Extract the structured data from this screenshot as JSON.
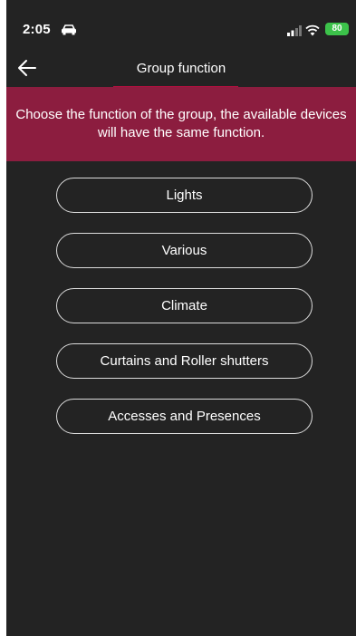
{
  "status_bar": {
    "time": "2:05",
    "battery": "80"
  },
  "header": {
    "title": "Group function"
  },
  "banner": {
    "text": "Choose the function of the group, the available devices will have the same function."
  },
  "options": [
    {
      "label": "Lights"
    },
    {
      "label": "Various"
    },
    {
      "label": "Climate"
    },
    {
      "label": "Curtains and Roller shutters"
    },
    {
      "label": "Accesses and Presences"
    }
  ],
  "colors": {
    "background": "#232323",
    "accent": "#8c1d3f",
    "underline": "#b0103f",
    "battery": "#3cc24a"
  }
}
